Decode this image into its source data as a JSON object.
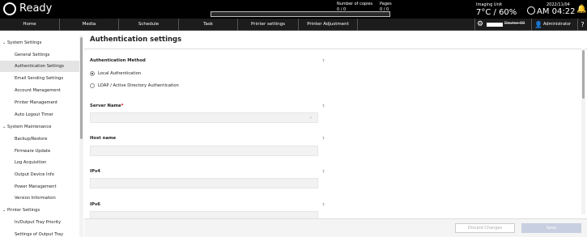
{
  "status_bar": {
    "state": "Ready",
    "copies_label": "Number of copies",
    "copies_value": "0 / 0",
    "pages_label": "Pages",
    "pages_value": "0 / 0",
    "progress_fraction": 0,
    "imaging_unit_label": "Imaging Unit",
    "imaging_unit_value": "7°C / 60%",
    "date": "2022/11/04",
    "time": "AM 04:22"
  },
  "nav": {
    "tabs": [
      {
        "label": "Home"
      },
      {
        "label": "Media"
      },
      {
        "label": "Schedule"
      },
      {
        "label": "Task"
      },
      {
        "label": "Printer settings"
      },
      {
        "label": "Printer Adjustment"
      }
    ],
    "printer_status_label": "Device-00",
    "user": "Administrator"
  },
  "sidebar": {
    "sections": [
      {
        "label": "System Settings",
        "items": [
          "General Settings",
          "Authentication Settings",
          "Email Sending Settings",
          "Account Management",
          "Printer Management",
          "Auto Logout Timer"
        ]
      },
      {
        "label": "System Maintenance",
        "items": [
          "Backup/Restore",
          "Firmware Update",
          "Log Acquisition",
          "Output Device Info",
          "Power Management",
          "Version Information"
        ]
      },
      {
        "label": "Printer Settings",
        "items": [
          "In/Output Tray Priority",
          "Settings of Output Tray"
        ]
      }
    ],
    "active_item": "Authentication Settings"
  },
  "main": {
    "title": "Authentication settings",
    "auth_method_label": "Authentication Method",
    "auth_options": [
      "Local Authentication",
      "LDAP / Active Directory Authentication"
    ],
    "auth_selected": "Local Authentication",
    "server_name_label": "Server Name",
    "server_name_value": "",
    "host_name_label": "Host name",
    "host_name_value": "",
    "ipv4_label": "IPv4",
    "ipv4_value": "",
    "ipv6_label": "IPv6",
    "ipv6_value": "",
    "help_symbol": "?"
  },
  "footer": {
    "discard_label": "Discard Changes",
    "save_label": "Save"
  },
  "icons": {
    "ready": "ready-circle-icon",
    "clock": "clock-icon",
    "bell": "bell-icon",
    "gear": "gear-icon",
    "user": "user-icon",
    "help": "help-icon",
    "printer": "printer-icon"
  }
}
